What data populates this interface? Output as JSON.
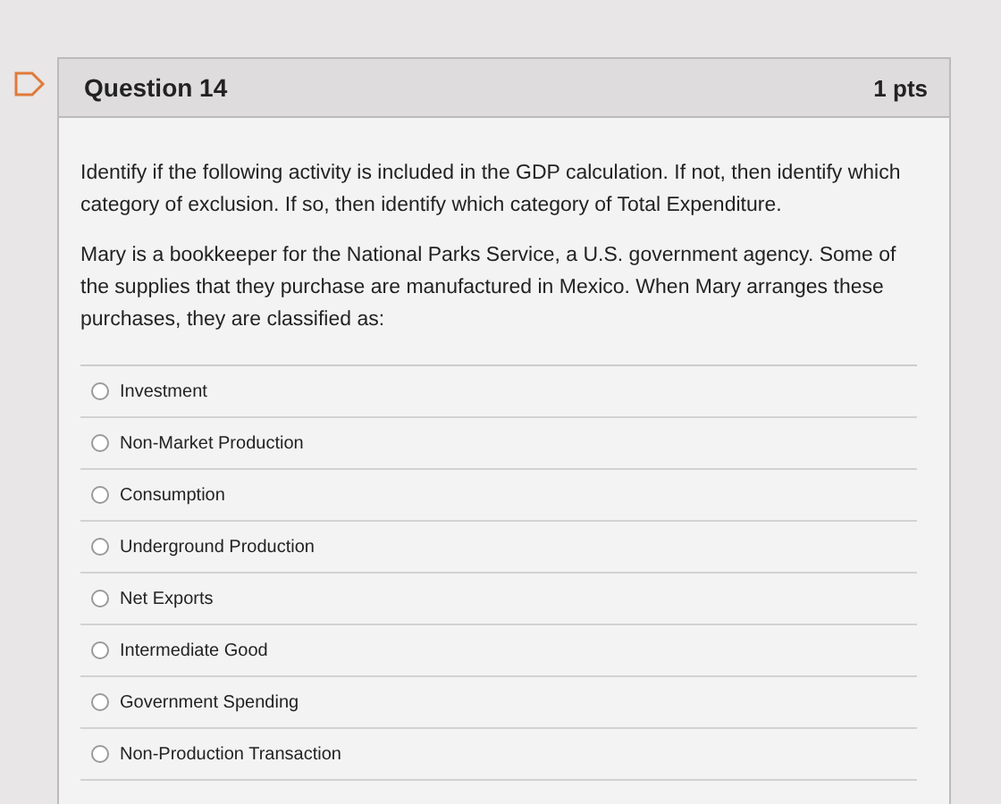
{
  "question": {
    "title": "Question 14",
    "points": "1 pts",
    "paragraphs": [
      "Identify if the following activity is included in the GDP calculation. If not, then identify which category of exclusion. If so, then identify which category of Total Expenditure.",
      "Mary is a bookkeeper for the National Parks Service, a U.S. government agency. Some of the supplies that they purchase are manufactured in Mexico. When Mary arranges these purchases, they are classified as:"
    ],
    "answers": [
      {
        "label": "Investment",
        "selected": false
      },
      {
        "label": "Non-Market Production",
        "selected": false
      },
      {
        "label": "Consumption",
        "selected": false
      },
      {
        "label": "Underground Production",
        "selected": false
      },
      {
        "label": "Net Exports",
        "selected": false
      },
      {
        "label": "Intermediate Good",
        "selected": false
      },
      {
        "label": "Government Spending",
        "selected": false
      },
      {
        "label": "Non-Production Transaction",
        "selected": false
      }
    ]
  }
}
